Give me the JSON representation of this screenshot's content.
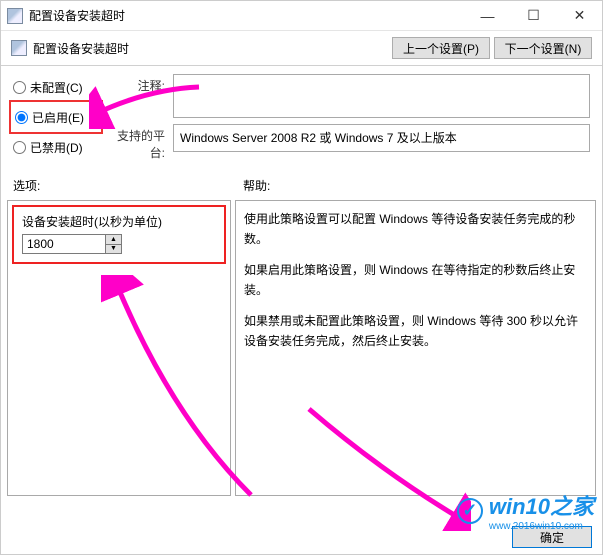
{
  "window": {
    "title": "配置设备安装超时"
  },
  "header": {
    "title": "配置设备安装超时",
    "prev_btn": "上一个设置(P)",
    "next_btn": "下一个设置(N)"
  },
  "radios": {
    "not_configured": "未配置(C)",
    "enabled": "已启用(E)",
    "disabled": "已禁用(D)",
    "selected": "enabled"
  },
  "fields": {
    "comment_label": "注释:",
    "comment_value": "",
    "platform_label": "支持的平台:",
    "platform_value": "Windows Server 2008 R2 或 Windows 7 及以上版本"
  },
  "sections": {
    "options_label": "选项:",
    "help_label": "帮助:"
  },
  "options": {
    "timeout_label": "设备安装超时(以秒为单位)",
    "timeout_value": "1800"
  },
  "help": {
    "p1": "使用此策略设置可以配置 Windows 等待设备安装任务完成的秒数。",
    "p2": "如果启用此策略设置，则 Windows 在等待指定的秒数后终止安装。",
    "p3": "如果禁用或未配置此策略设置，则 Windows 等待 300 秒以允许设备安装任务完成，然后终止安装。"
  },
  "footer": {
    "ok": "确定"
  },
  "watermark": {
    "brand": "win10之家",
    "url": "www.2016win10.com"
  }
}
